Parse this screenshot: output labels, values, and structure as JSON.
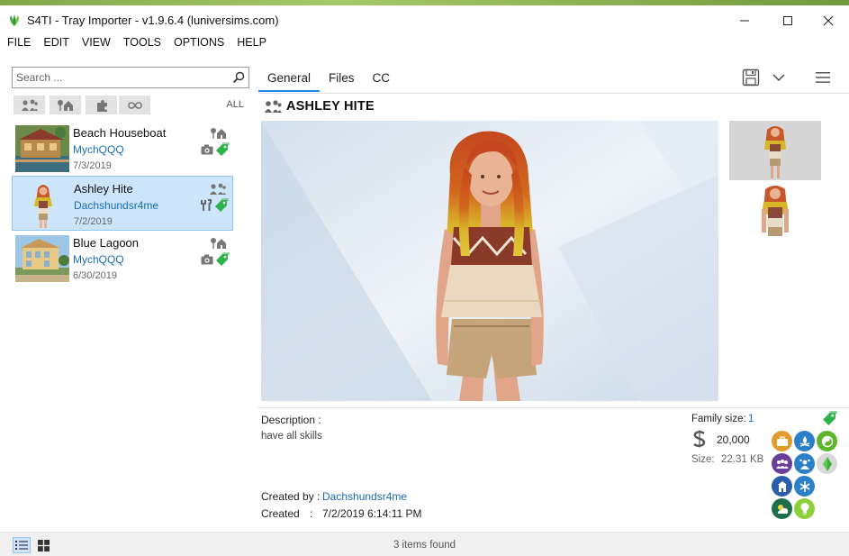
{
  "window": {
    "title": "S4TI - Tray Importer - v1.9.6.4  (luniversims.com)",
    "accent": "#1e88e5",
    "link_color": "#1c6cb3"
  },
  "menu": [
    "FILE",
    "EDIT",
    "VIEW",
    "TOOLS",
    "OPTIONS",
    "HELP"
  ],
  "sidebar": {
    "search_placeholder": "Search ...",
    "filters": [
      "household-icon",
      "lot-icon",
      "room-icon",
      "infinity-icon"
    ],
    "filter_all": "ALL",
    "items": [
      {
        "name": "Beach Houseboat",
        "author": "MychQQQ",
        "date": "7/3/2019",
        "type_icon": "lot-icon",
        "status_icons": [
          "camera-icon",
          "tag-icon"
        ]
      },
      {
        "name": "Ashley Hite",
        "author": "Dachshundsr4me",
        "date": "7/2/2019",
        "type_icon": "household-icon",
        "status_icons": [
          "wrench-icon",
          "tag-icon"
        ]
      },
      {
        "name": "Blue Lagoon",
        "author": "MychQQQ",
        "date": "6/30/2019",
        "type_icon": "lot-icon",
        "status_icons": [
          "camera-icon",
          "tag-icon"
        ]
      }
    ]
  },
  "tabs": [
    "General",
    "Files",
    "CC"
  ],
  "detail": {
    "title": "ASHLEY HITE",
    "description_label": "Description :",
    "description": "have all skills",
    "family_size_label": "Family size:",
    "family_size": "1",
    "funds": "20,000",
    "size_label": "Size:",
    "size": "22.31 KB",
    "created_by_label": "Created by :",
    "created_by": "Dachshundsr4me",
    "created_label": "Created",
    "created_colon": ":",
    "created": "7/2/2019 6:14:11 PM",
    "traits": [
      {
        "icon": "briefcase-icon",
        "color": "#e39b2c"
      },
      {
        "icon": "campfire-icon",
        "color": "#2d80c8"
      },
      {
        "icon": "yin-yang-icon",
        "color": "#5fb52a"
      },
      {
        "icon": "group-icon",
        "color": "#6a3f9a"
      },
      {
        "icon": "social-icon",
        "color": "#2d80c8"
      },
      {
        "icon": "plumbob-icon",
        "color": "#d9d9d9"
      },
      {
        "icon": "building-icon",
        "color": "#2a5ea8"
      },
      {
        "icon": "snowflake-icon",
        "color": "#2d80c8"
      },
      {
        "icon": "weather-icon",
        "color": "#1e6e4a"
      },
      {
        "icon": "bulb-icon",
        "color": "#8ecf3c"
      }
    ]
  },
  "status": {
    "text": "3 items found"
  }
}
